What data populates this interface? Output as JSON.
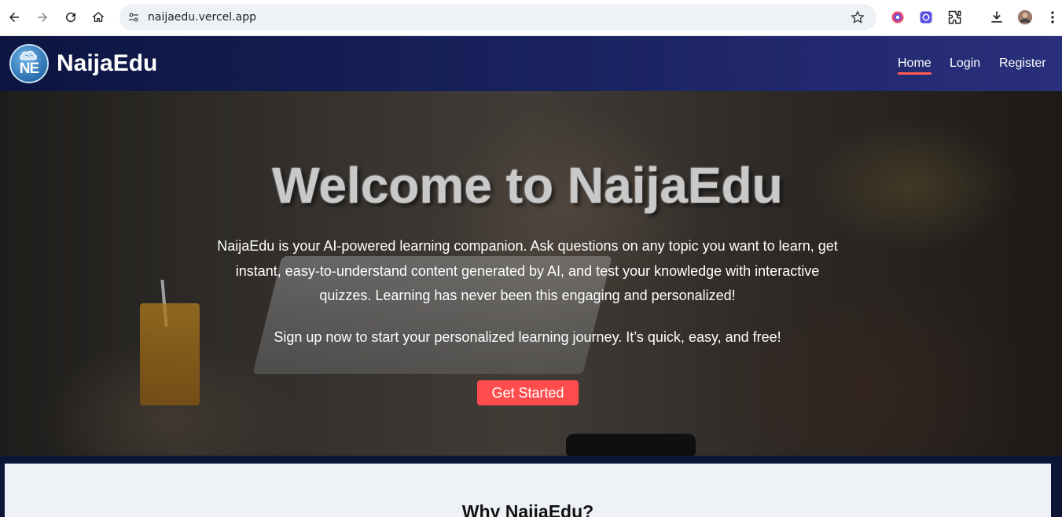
{
  "browser": {
    "url": "naijaedu.vercel.app",
    "icons": [
      "back-icon",
      "forward-icon",
      "reload-icon",
      "home-icon",
      "site-info-icon",
      "bookmark-star-icon",
      "extension-puzzle-icon",
      "download-icon",
      "profile-avatar",
      "menu-kebab-icon"
    ]
  },
  "header": {
    "logo_text": "NE",
    "brand": "NaijaEdu",
    "nav": {
      "home": "Home",
      "login": "Login",
      "register": "Register"
    },
    "accent_color": "#ff5a54"
  },
  "hero": {
    "title": "Welcome to NaijaEdu",
    "description": "NaijaEdu is your AI-powered learning companion. Ask questions on any topic you want to learn, get instant, easy-to-understand content generated by AI, and test your knowledge with interactive quizzes. Learning has never been this engaging and personalized!",
    "signup_text": "Sign up now to start your personalized learning journey. It’s quick, easy, and free!",
    "cta_label": "Get Started",
    "cta_color": "#ff4d4d"
  },
  "section": {
    "title": "Why NaijaEdu?"
  }
}
